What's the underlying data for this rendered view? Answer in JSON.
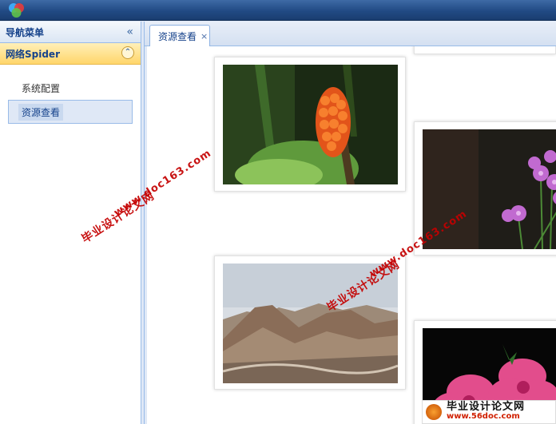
{
  "nav": {
    "header": "导航菜单",
    "collapse_icon": "«",
    "group": {
      "label": "网络Spider",
      "toggle_icon": "⌃"
    },
    "items": [
      {
        "label": "系统配置",
        "selected": false
      },
      {
        "label": "资源查看",
        "selected": true
      }
    ]
  },
  "tabs": [
    {
      "label": "资源查看",
      "close": "×"
    }
  ],
  "images": [
    {
      "subject": "orange berry cluster"
    },
    {
      "subject": "pink wood sorrel flowers"
    },
    {
      "subject": "desert mountains"
    },
    {
      "subject": "pink hibiscus flowers"
    }
  ],
  "watermarks": {
    "line1": "毕业设计论文网",
    "line2": "www.doc163.com",
    "footer_title": "毕业设计论文网",
    "footer_url": "www.56doc.com"
  },
  "colors": {
    "accent": "#15428b",
    "watermark": "#c40000",
    "group_header": "#ffd66b"
  }
}
